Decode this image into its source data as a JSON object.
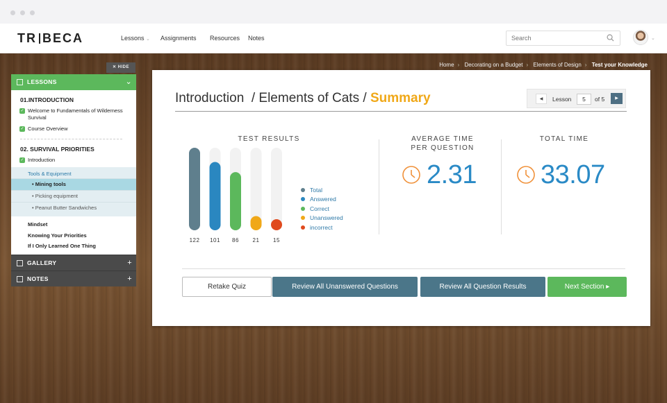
{
  "app": {
    "logo_left": "TR",
    "logo_right": "BECA"
  },
  "nav": {
    "items": [
      {
        "label": "Lessons",
        "caret": "⌄"
      },
      {
        "label": "Assignments"
      },
      {
        "label": "Resources"
      },
      {
        "label": "Notes"
      }
    ]
  },
  "search": {
    "placeholder": "Search"
  },
  "breadcrumb": {
    "items": [
      "Home",
      "Decorating on a Budget",
      "Elements of Design"
    ],
    "current": "Test your Knowledge"
  },
  "sidebar": {
    "hide_label": "✕  HIDE",
    "lessons_label": "LESSONS",
    "modules": [
      {
        "title": "01.INTRODUCTION",
        "lessons": [
          "Welcome to Fundamentals of Wilderness Survival",
          "Course Overview"
        ]
      },
      {
        "title": "02. SURVIVAL PRIORITIES",
        "lessons": [
          "Introduction"
        ]
      }
    ],
    "subgroup": {
      "title": "Tools & Equipment",
      "items": [
        "Mining tools",
        "Picking equipment",
        "Peanut Butter Sandwiches"
      ],
      "active_index": 0
    },
    "plain_items": [
      "Mindset",
      "Knowing Your Priorities",
      "If I Only Learned One Thing"
    ],
    "gallery_label": "GALLERY",
    "notes_label": "NOTES"
  },
  "main": {
    "title_part1": "Introduction",
    "title_part2": "/ Elements of Cats /",
    "title_part3": "Summary",
    "lesson_nav": {
      "label": "Lesson",
      "current": "5",
      "of_label": "of 5"
    },
    "test_results_heading": "TEST RESULTS",
    "avg_time_heading_1": "AVERAGE TIME",
    "avg_time_heading_2": "PER QUESTION",
    "avg_time_value": "2.31",
    "total_time_heading": "TOTAL TIME",
    "total_time_value": "33.07",
    "buttons": {
      "retake": "Retake Quiz",
      "review_unanswered": "Review All Unanswered Questions",
      "review_results": "Review All Question Results",
      "next": "Next Section  ▸"
    }
  },
  "colors": {
    "total": "#5f7f8d",
    "answered": "#2a87c0",
    "correct": "#5cb85c",
    "unanswered": "#f0a818",
    "incorrect": "#e04a1e"
  },
  "chart_data": {
    "type": "bar",
    "title": "TEST RESULTS",
    "categories": [
      "Total",
      "Answered",
      "Correct",
      "Unanswered",
      "incorrect"
    ],
    "values": [
      122,
      101,
      86,
      21,
      15
    ],
    "value_labels": [
      "122",
      "101",
      "86",
      "21",
      "15"
    ],
    "colors": [
      "#5f7f8d",
      "#2a87c0",
      "#5cb85c",
      "#f0a818",
      "#e04a1e"
    ],
    "ylim": [
      0,
      122
    ],
    "legend": "right",
    "grid": false
  }
}
